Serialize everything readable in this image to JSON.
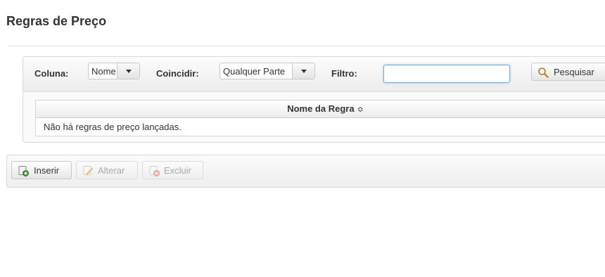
{
  "page": {
    "title": "Regras de Preço"
  },
  "filter": {
    "coluna_label": "Coluna:",
    "coluna_value": "Nome",
    "coincidir_label": "Coincidir:",
    "coincidir_value": "Qualquer Parte",
    "filtro_label": "Filtro:",
    "filtro_value": "",
    "search_label": "Pesquisar"
  },
  "table": {
    "header": "Nome da Regra",
    "sort_indicator": "≎",
    "empty_message": "Não há regras de preço lançadas."
  },
  "actions": {
    "insert_label": "Inserir",
    "edit_label": "Alterar",
    "delete_label": "Excluir"
  }
}
